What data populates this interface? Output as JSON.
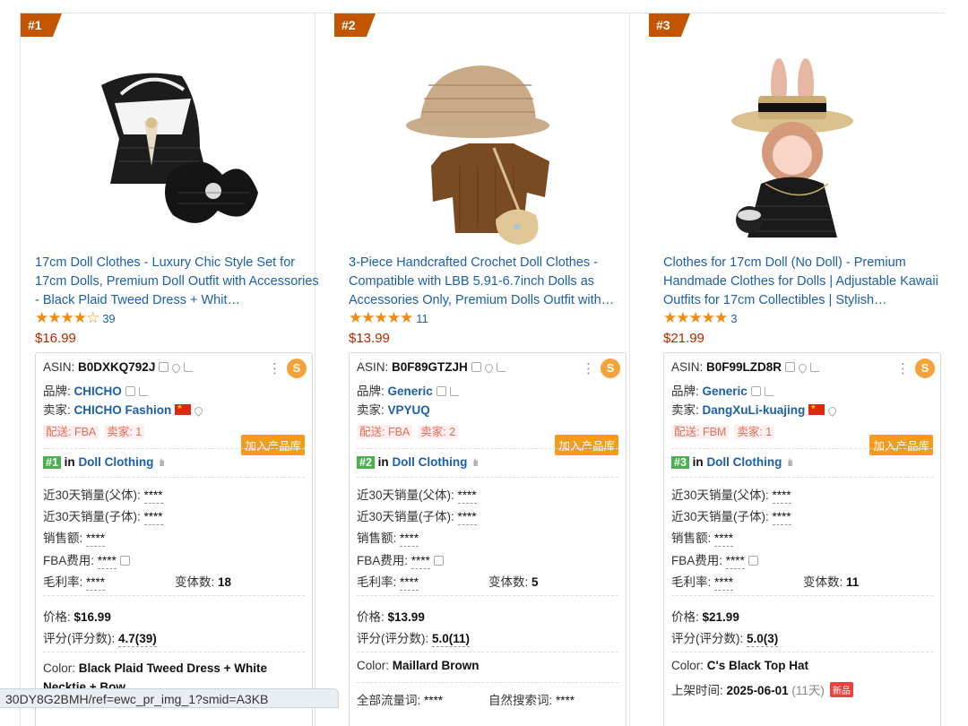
{
  "products": [
    {
      "rank_tag": "#1",
      "title": "17cm Doll Clothes - Luxury Chic Style Set for 17cm Dolls, Premium Doll Outfit with Accessories - Black Plaid Tweed Dress + Whit…",
      "stars": "★★★★☆",
      "rating_value": 4.5,
      "review_count": "39",
      "price": "$16.99",
      "asin_label": "ASIN:",
      "asin": "B0DXKQ792J",
      "brand_label": "品牌:",
      "brand": "CHICHO",
      "seller_label": "卖家:",
      "seller": "CHICHO Fashion",
      "ship": "配送: FBA",
      "sellers_count": "卖家: 1",
      "add_btn": "加入产品库",
      "rank_badge": "#1",
      "rank_in": "in",
      "category": "Doll Clothing",
      "sales_parent_label": "近30天销量(父体):",
      "sales_parent": "****",
      "sales_child_label": "近30天销量(子体):",
      "sales_child": "****",
      "revenue_label": "销售额:",
      "revenue": "****",
      "fba_label": "FBA费用:",
      "fba": "****",
      "margin_label": "毛利率:",
      "margin": "****",
      "variants_label": "变体数:",
      "variants": "18",
      "price_label": "价格:",
      "price_val": "$16.99",
      "score_label": "评分(评分数):",
      "score": "4.7(39)",
      "color_label": "Color:",
      "color": "Black Plaid Tweed Dress + White Necktie + Bow"
    },
    {
      "rank_tag": "#2",
      "title": "3-Piece Handcrafted Crochet Doll Clothes - Compatible with LBB 5.91-6.7inch Dolls as Accessories Only, Premium Dolls Outfit with…",
      "stars": "★★★★★",
      "rating_value": 5,
      "review_count": "11",
      "price": "$13.99",
      "asin_label": "ASIN:",
      "asin": "B0F89GTZJH",
      "brand_label": "品牌:",
      "brand": "Generic",
      "seller_label": "卖家:",
      "seller": "VPYUQ",
      "ship": "配送: FBA",
      "sellers_count": "卖家: 2",
      "add_btn": "加入产品库",
      "rank_badge": "#2",
      "rank_in": "in",
      "category": "Doll Clothing",
      "sales_parent_label": "近30天销量(父体):",
      "sales_parent": "****",
      "sales_child_label": "近30天销量(子体):",
      "sales_child": "****",
      "revenue_label": "销售额:",
      "revenue": "****",
      "fba_label": "FBA费用:",
      "fba": "****",
      "margin_label": "毛利率:",
      "margin": "****",
      "variants_label": "变体数:",
      "variants": "5",
      "price_label": "价格:",
      "price_val": "$13.99",
      "score_label": "评分(评分数):",
      "score": "5.0(11)",
      "color_label": "Color:",
      "color": "Maillard Brown",
      "traffic_label": "全部流量词:",
      "traffic": "****",
      "organic_label": "自然搜索词:",
      "organic": "****"
    },
    {
      "rank_tag": "#3",
      "title": "Clothes for 17cm Doll (No Doll) - Premium Handmade Clothes for Dolls | Adjustable Kawaii Outfits for 17cm Collectibles | Stylish…",
      "stars": "★★★★★",
      "rating_value": 5,
      "review_count": "3",
      "price": "$21.99",
      "asin_label": "ASIN:",
      "asin": "B0F99LZD8R",
      "brand_label": "品牌:",
      "brand": "Generic",
      "seller_label": "卖家:",
      "seller": "DangXuLi-kuajing",
      "ship": "配送: FBM",
      "sellers_count": "卖家: 1",
      "add_btn": "加入产品库",
      "rank_badge": "#3",
      "rank_in": "in",
      "category": "Doll Clothing",
      "sales_parent_label": "近30天销量(父体):",
      "sales_parent": "****",
      "sales_child_label": "近30天销量(子体):",
      "sales_child": "****",
      "revenue_label": "销售额:",
      "revenue": "****",
      "fba_label": "FBA费用:",
      "fba": "****",
      "margin_label": "毛利率:",
      "margin": "****",
      "variants_label": "变体数:",
      "variants": "11",
      "price_label": "价格:",
      "price_val": "$21.99",
      "score_label": "评分(评分数):",
      "score": "5.0(3)",
      "color_label": "Color:",
      "color": "C's Black Top Hat",
      "listed_label": "上架时间:",
      "listed": "2025-06-01",
      "listed_days": "(11天)",
      "new_badge": "新品"
    }
  ],
  "status_url": "30DY8G2BMH/ref=ewc_pr_img_1?smid=A3KB",
  "accent": "#c45500"
}
